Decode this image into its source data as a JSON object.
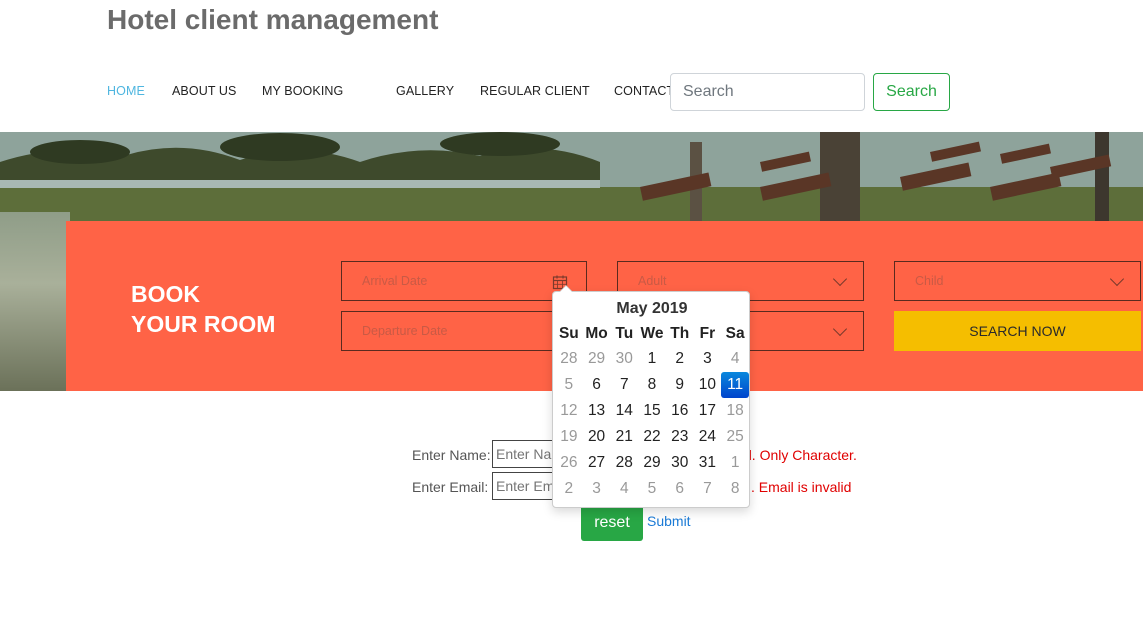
{
  "site": {
    "title": "Hotel client management"
  },
  "nav": {
    "items": [
      {
        "label": "HOME",
        "active": true
      },
      {
        "label": "ABOUT US"
      },
      {
        "label": "MY BOOKING"
      },
      {
        "label": "GALLERY"
      },
      {
        "label": "REGULAR CLIENT"
      },
      {
        "label": "CONTACT"
      }
    ],
    "search_placeholder": "Search",
    "search_button": "Search"
  },
  "booking": {
    "title_line1": "BOOK",
    "title_line2": "YOUR ROOM",
    "arrival_placeholder": "Arrival Date",
    "departure_placeholder": "Departure Date",
    "adult_label": "Adult",
    "child_label": "Child",
    "search_now": "SEARCH NOW"
  },
  "datepicker": {
    "month_label": "May 2019",
    "weekdays": [
      "Su",
      "Mo",
      "Tu",
      "We",
      "Th",
      "Fr",
      "Sa"
    ],
    "days": [
      [
        "28",
        "29",
        "30",
        "1",
        "2",
        "3",
        "4"
      ],
      [
        "5",
        "6",
        "7",
        "8",
        "9",
        "10",
        "11"
      ],
      [
        "12",
        "13",
        "14",
        "15",
        "16",
        "17",
        "18"
      ],
      [
        "19",
        "20",
        "21",
        "22",
        "23",
        "24",
        "25"
      ],
      [
        "26",
        "27",
        "28",
        "29",
        "30",
        "31",
        "1"
      ],
      [
        "2",
        "3",
        "4",
        "5",
        "6",
        "7",
        "8"
      ]
    ],
    "selected": "11"
  },
  "form": {
    "name_label": "Enter Name:",
    "name_placeholder": "Enter Name",
    "name_error": "d. Only Character.",
    "email_label": "Enter Email:",
    "email_placeholder": "Enter Email",
    "email_error": ". Email is invalid",
    "reset_label": "reset",
    "submit_label": "Submit"
  },
  "colors": {
    "accent_nav": "#4fb6e0",
    "panel": "#ff6346",
    "search_now": "#f5be00",
    "success": "#28a745",
    "error": "#e00000",
    "selected_day": "#0066cc"
  }
}
